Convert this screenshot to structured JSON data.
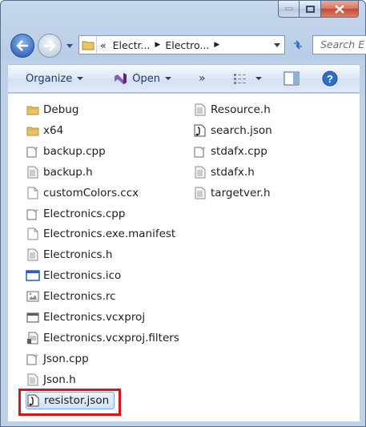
{
  "window": {
    "caption": {
      "minimize": "minimize",
      "maximize": "maximize",
      "close": "close"
    }
  },
  "address": {
    "overflow": "«",
    "crumbs": [
      "Electr...",
      "Electro..."
    ],
    "search_placeholder": "Search E"
  },
  "toolbar": {
    "organize": "Organize",
    "open": "Open",
    "more": "»"
  },
  "files": {
    "col1": [
      {
        "name": "Debug",
        "icon": "folder-icon"
      },
      {
        "name": "x64",
        "icon": "folder-icon"
      },
      {
        "name": "backup.cpp",
        "icon": "cpp-file-icon"
      },
      {
        "name": "backup.h",
        "icon": "header-file-icon"
      },
      {
        "name": "customColors.ccx",
        "icon": "blank-file-icon"
      },
      {
        "name": "Electronics.cpp",
        "icon": "cpp-file-icon"
      },
      {
        "name": "Electronics.exe.manifest",
        "icon": "blank-file-icon"
      },
      {
        "name": "Electronics.h",
        "icon": "header-file-icon"
      },
      {
        "name": "Electronics.ico",
        "icon": "ico-file-icon"
      },
      {
        "name": "Electronics.rc",
        "icon": "rc-file-icon"
      },
      {
        "name": "Electronics.vcxproj",
        "icon": "vcxproj-file-icon"
      },
      {
        "name": "Electronics.vcxproj.filters",
        "icon": "filters-file-icon"
      },
      {
        "name": "Json.cpp",
        "icon": "cpp-file-icon"
      },
      {
        "name": "Json.h",
        "icon": "header-file-icon"
      },
      {
        "name": "resistor.json",
        "icon": "json-file-icon",
        "selected": true
      }
    ],
    "col2": [
      {
        "name": "Resource.h",
        "icon": "header-file-icon"
      },
      {
        "name": "search.json",
        "icon": "json-file-icon"
      },
      {
        "name": "stdafx.cpp",
        "icon": "cpp-file-icon"
      },
      {
        "name": "stdafx.h",
        "icon": "header-file-icon"
      },
      {
        "name": "targetver.h",
        "icon": "header-file-icon"
      }
    ]
  },
  "accent": {
    "highlight": "#d9141b",
    "selection": "#cfe1f7"
  }
}
